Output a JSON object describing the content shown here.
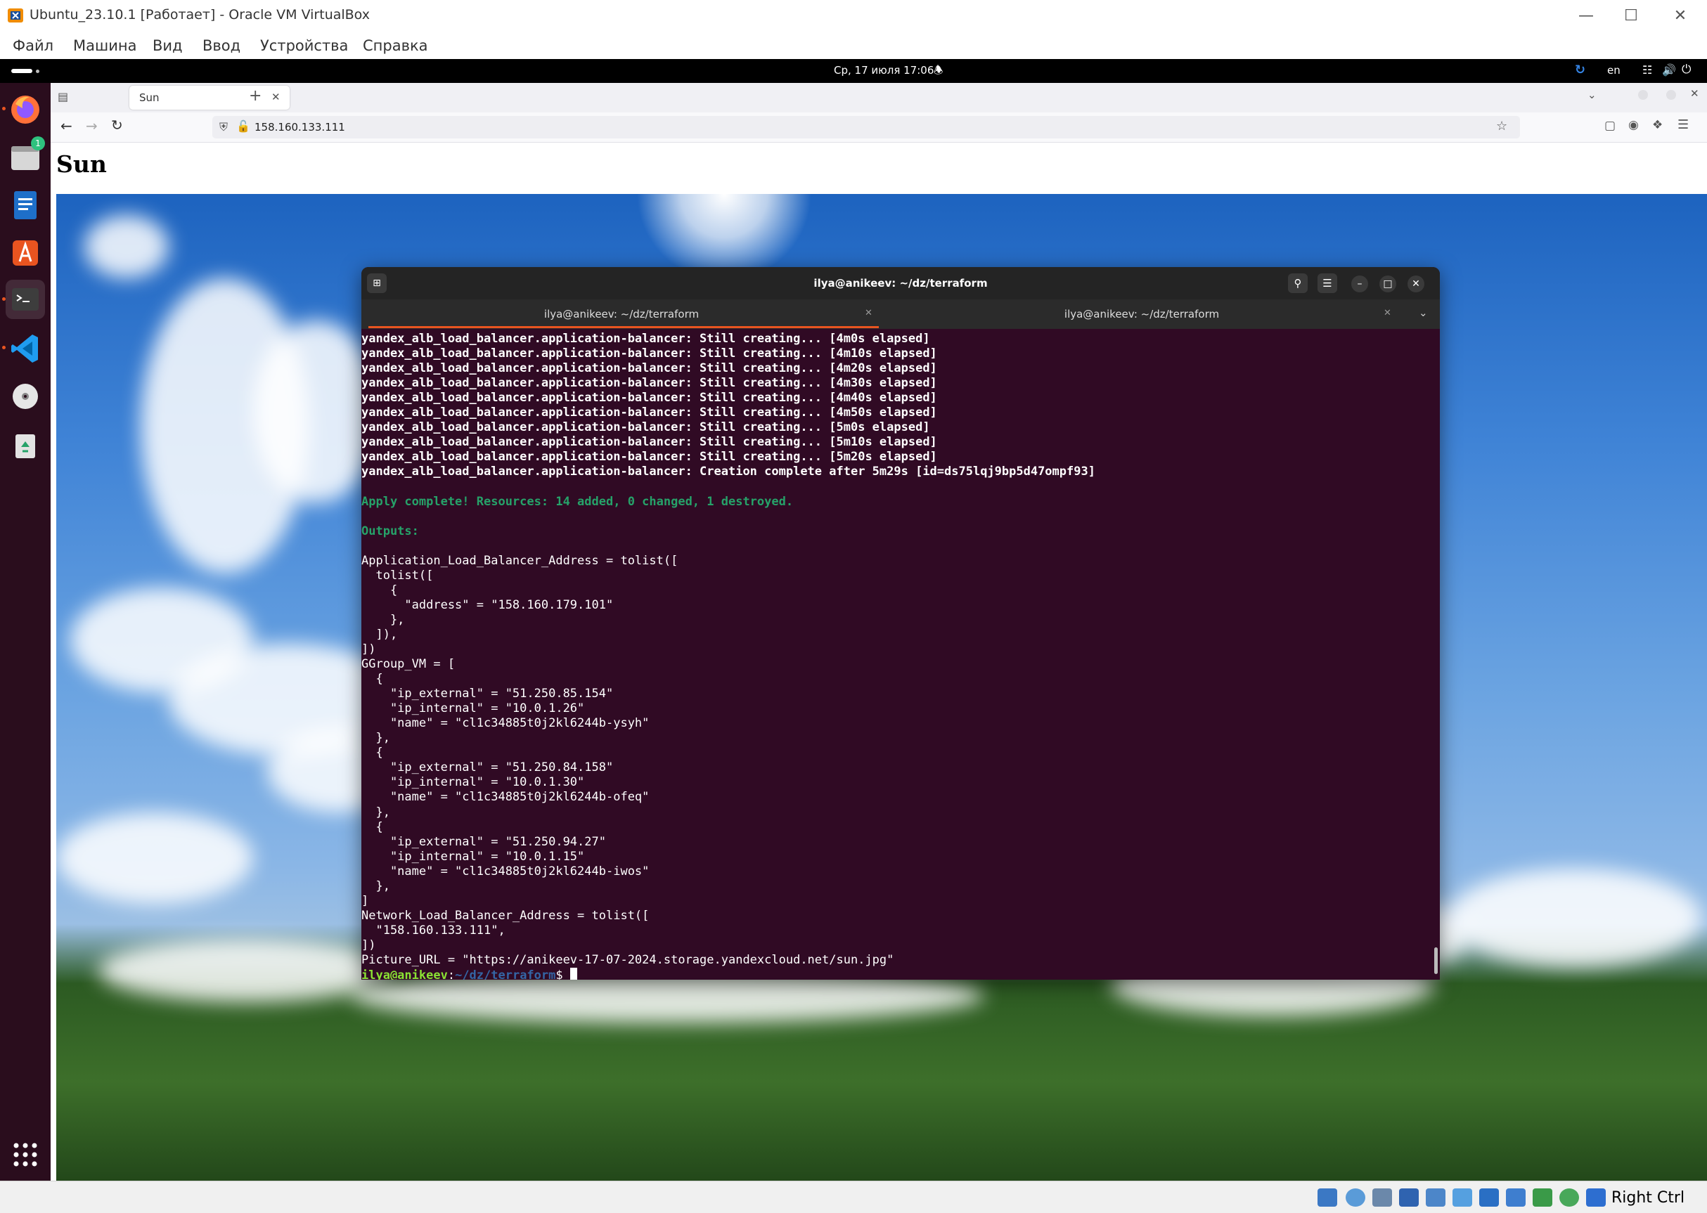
{
  "vbox": {
    "window_title": "Ubuntu_23.10.1 [Работает] - Oracle VM VirtualBox",
    "menu": [
      "Файл",
      "Машина",
      "Вид",
      "Ввод",
      "Устройства",
      "Справка"
    ],
    "host_key_label": "Right Ctrl"
  },
  "gnome": {
    "clock": "Ср, 17 июля  17:06",
    "input_language": "en"
  },
  "dock": {
    "files_badge": "1"
  },
  "firefox": {
    "tab_title": "Sun",
    "url": "158.160.133.111",
    "page_heading": "Sun"
  },
  "terminal": {
    "window_title": "ilya@anikeev: ~/dz/terraform",
    "tabs": [
      "ilya@anikeev: ~/dz/terraform",
      "ilya@anikeev: ~/dz/terraform"
    ],
    "lines": [
      "yandex_alb_load_balancer.application-balancer: Still creating... [4m0s elapsed]",
      "yandex_alb_load_balancer.application-balancer: Still creating... [4m10s elapsed]",
      "yandex_alb_load_balancer.application-balancer: Still creating... [4m20s elapsed]",
      "yandex_alb_load_balancer.application-balancer: Still creating... [4m30s elapsed]",
      "yandex_alb_load_balancer.application-balancer: Still creating... [4m40s elapsed]",
      "yandex_alb_load_balancer.application-balancer: Still creating... [4m50s elapsed]",
      "yandex_alb_load_balancer.application-balancer: Still creating... [5m0s elapsed]",
      "yandex_alb_load_balancer.application-balancer: Still creating... [5m10s elapsed]",
      "yandex_alb_load_balancer.application-balancer: Still creating... [5m20s elapsed]",
      "yandex_alb_load_balancer.application-balancer: Creation complete after 5m29s [id=ds75lqj9bp5d47ompf93]",
      "",
      "Apply complete! Resources: 14 added, 0 changed, 1 destroyed.",
      "",
      "Outputs:",
      "",
      "Application_Load_Balancer_Address = tolist([",
      "  tolist([",
      "    {",
      "      \"address\" = \"158.160.179.101\"",
      "    },",
      "  ]),",
      "])",
      "GGroup_VM = [",
      "  {",
      "    \"ip_external\" = \"51.250.85.154\"",
      "    \"ip_internal\" = \"10.0.1.26\"",
      "    \"name\" = \"cl1c34885t0j2kl6244b-ysyh\"",
      "  },",
      "  {",
      "    \"ip_external\" = \"51.250.84.158\"",
      "    \"ip_internal\" = \"10.0.1.30\"",
      "    \"name\" = \"cl1c34885t0j2kl6244b-ofeq\"",
      "  },",
      "  {",
      "    \"ip_external\" = \"51.250.94.27\"",
      "    \"ip_internal\" = \"10.0.1.15\"",
      "    \"name\" = \"cl1c34885t0j2kl6244b-iwos\"",
      "  },",
      "]",
      "Network_Load_Balancer_Address = tolist([",
      "  \"158.160.133.111\",",
      "])",
      "Picture_URL = \"https://anikeev-17-07-2024.storage.yandexcloud.net/sun.jpg\""
    ],
    "prompt_user": "ilya@anikeev",
    "prompt_sep": ":",
    "prompt_path": "~/dz/terraform",
    "prompt_end": "$ "
  },
  "colors": {
    "terminal_bg": "#300a24",
    "apply_green": "#26a269",
    "prompt_user": "#8ae234",
    "prompt_path": "#3465a4",
    "ubuntu_orange": "#e95420"
  }
}
